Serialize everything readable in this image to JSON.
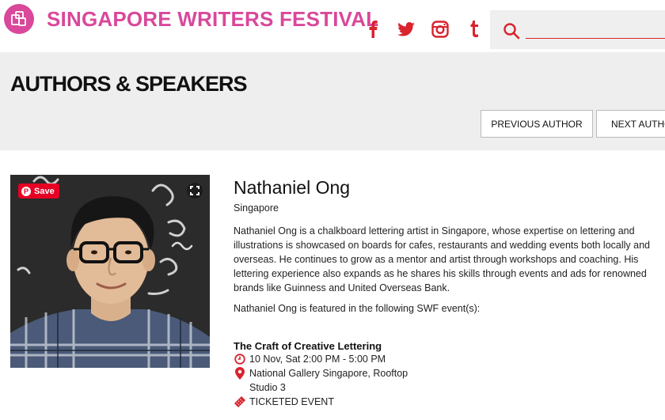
{
  "header": {
    "site_title": "SINGAPORE WRITERS FESTIVAL",
    "logo_icon": "festival-logo-icon",
    "social": [
      {
        "name": "facebook",
        "glyph": "f"
      },
      {
        "name": "twitter",
        "glyph": "twitter-bird"
      },
      {
        "name": "instagram",
        "glyph": "instagram-camera"
      },
      {
        "name": "tumblr",
        "glyph": "t"
      }
    ],
    "search": {
      "placeholder": "",
      "value": ""
    }
  },
  "band": {
    "page_title": "AUTHORS & SPEAKERS",
    "previous_label": "PREVIOUS AUTHOR",
    "next_label": "NEXT AUTHOR"
  },
  "photo": {
    "save_label": "Save",
    "pin_glyph": "P"
  },
  "author": {
    "name": "Nathaniel Ong",
    "country": "Singapore",
    "bio": "Nathaniel Ong is a chalkboard lettering artist in Singapore, whose expertise on lettering and illustrations is showcased on boards for cafes, restaurants and wedding events both locally and overseas. He continues to grow as a mentor and artist through workshops and coaching. His lettering experience also expands as he shares his skills through events and ads for renowned brands like Guinness and United Overseas Bank.",
    "featured_text": "Nathaniel Ong is featured in the following SWF event(s):"
  },
  "event": {
    "title": "The Craft of Creative Lettering",
    "datetime": "10 Nov, Sat 2:00 PM - 5:00 PM",
    "venue_line1": "National Gallery Singapore, Rooftop",
    "venue_line2": "Studio 3",
    "ticket": "TICKETED EVENT"
  },
  "colors": {
    "brand_pink": "#d9489a",
    "accent_red": "#d9232d",
    "band_grey": "#eeeeee"
  }
}
